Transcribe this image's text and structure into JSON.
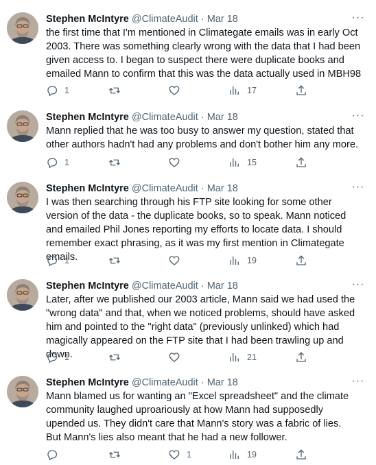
{
  "tweets": [
    {
      "name": "Stephen McIntyre",
      "handle": "@ClimateAudit",
      "date": "Mar 18",
      "text": "the first time that I'm mentioned in Climategate emails was in early Oct 2003. There was something clearly wrong with the data that I had been given access to. I began to suspect there were duplicate books and emailed Mann to confirm that this was the data actually used in MBH98",
      "replies": "1",
      "retweets": "",
      "likes": "",
      "views": "17"
    },
    {
      "name": "Stephen McIntyre",
      "handle": "@ClimateAudit",
      "date": "Mar 18",
      "text": "Mann replied that he was too busy to answer my question, stated that other authors hadn't had any problems and don't bother him any more.",
      "replies": "1",
      "retweets": "",
      "likes": "",
      "views": "15"
    },
    {
      "name": "Stephen McIntyre",
      "handle": "@ClimateAudit",
      "date": "Mar 18",
      "text": "I was then searching through his FTP site looking for some other version of the data - the duplicate books, so to speak. Mann noticed and emailed Phil Jones reporting my efforts to locate data. I should remember exact phrasing, as it was my first mention in Climategate emails.",
      "replies": "1",
      "retweets": "",
      "likes": "",
      "views": "19"
    },
    {
      "name": "Stephen McIntyre",
      "handle": "@ClimateAudit",
      "date": "Mar 18",
      "text": "Later, after we published our 2003 article, Mann said we had used the \"wrong data\" and that, when we noticed problems, should have asked him and pointed to the \"right data\" (previously unlinked) which had magically appeared on the FTP site that I had been trawling up and down.",
      "replies": "1",
      "retweets": "",
      "likes": "",
      "views": "21"
    },
    {
      "name": "Stephen McIntyre",
      "handle": "@ClimateAudit",
      "date": "Mar 18",
      "text": "Mann blamed us for wanting an \"Excel spreadsheet\" and the climate community laughed uproariously at how Mann had supposedly upended us. They didn't care that Mann's story was a fabric of lies.\nBut Mann's lies also meant that he had a new follower.",
      "replies": "",
      "retweets": "",
      "likes": "1",
      "views": "19"
    }
  ],
  "ui": {
    "separator": "·",
    "more": "···"
  },
  "colors": {
    "text": "#0f1419",
    "secondary": "#536471",
    "background": "#ffffff"
  },
  "icons": [
    "reply-icon",
    "retweet-icon",
    "like-icon",
    "views-icon",
    "share-icon",
    "more-icon"
  ]
}
